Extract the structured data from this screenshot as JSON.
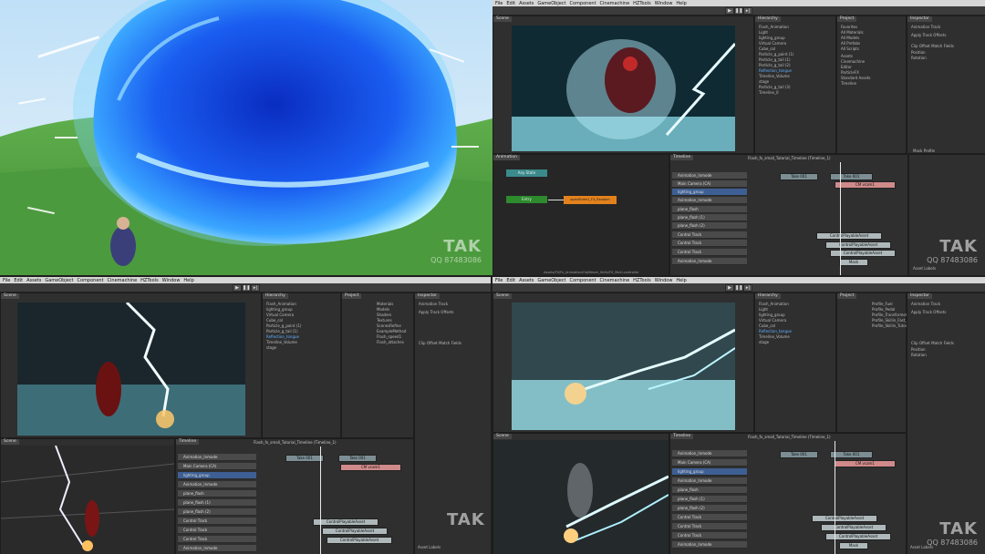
{
  "menu": [
    "File",
    "Edit",
    "Assets",
    "GameObject",
    "Component",
    "Cinemachine",
    "HZTools",
    "Window",
    "Help"
  ],
  "watermark": {
    "logo": "TAK",
    "qq": "QQ 87483086"
  },
  "panels": {
    "animation_tab": "Animation",
    "timeline_tab": "Timeline",
    "scene_tab": "Scene",
    "inspector_tab": "Inspector",
    "hierarchy_tab": "Hierarchy",
    "project_tab": "Project"
  },
  "hierarchy_items": [
    "Flash_Animation",
    "Light",
    "lighting_group",
    "Virtual Camera",
    "Cube_col",
    "Particle_g_point (1)",
    "Particle_g_tail (1)",
    "Particle_g_tail (2)",
    "Reflection_tongue",
    "Timeline_Volume",
    "stage",
    "Particle_g_tail (3)",
    "Timeline_0"
  ],
  "project_items": [
    "Favorites",
    "All Materials",
    "All Models",
    "All Prefabs",
    "All Scripts",
    "Assets",
    "Cinemachine",
    "Editor",
    "ParticleFX",
    "Standard Assets",
    "Timeline"
  ],
  "asset_files": [
    "Materials",
    "Models",
    "Shaders",
    "Textures",
    "ScenesRefine",
    "ExampleMethod",
    "Flash_speed1",
    "Flash_attaches",
    "Profile_Fuel",
    "Profile_Pedal",
    "Profile_Transformer",
    "Profile_Skillin_Fast_4",
    "Profile_Skillin_Tutorial"
  ],
  "tracks": [
    "Animation_Inmode",
    "Main Camera (CA)",
    "lighting_group",
    "Animation_Inmode",
    "plane_flash",
    "plane_flash (1)",
    "plane_flash (2)",
    "Control Track",
    "Control Track",
    "Control Track",
    "Animation_Inmode"
  ],
  "timeline_title": "Flash_fx_small_Tutorial_Timeline (Timeline_1)",
  "clips": {
    "take01": "Take 001",
    "take02": "Take 001",
    "cm": "CM vcam1",
    "ctrl_a": "ControlPlayableAsset",
    "ctrl_b": "ControlPlayableAsset",
    "ctrl_c": "ControlPlayableAsset",
    "mask": "Mask"
  },
  "animator_nodes": {
    "any": "Any State",
    "entry": "Entry",
    "state": "openStrike1_FX_Random"
  },
  "inspector": {
    "title": "Animation Track",
    "field1": "Apply Track Offsets",
    "section": "Clip Offset Match Fields",
    "pos": "Position",
    "rot": "Rotation"
  },
  "status_path": "Assets/FX/Fx_Animation/ObjMessh_Skills/FX_Multi.controller",
  "mode_label": "Mask Profile",
  "asset_labels": "Asset Labels",
  "accent": "#2f8bd6"
}
